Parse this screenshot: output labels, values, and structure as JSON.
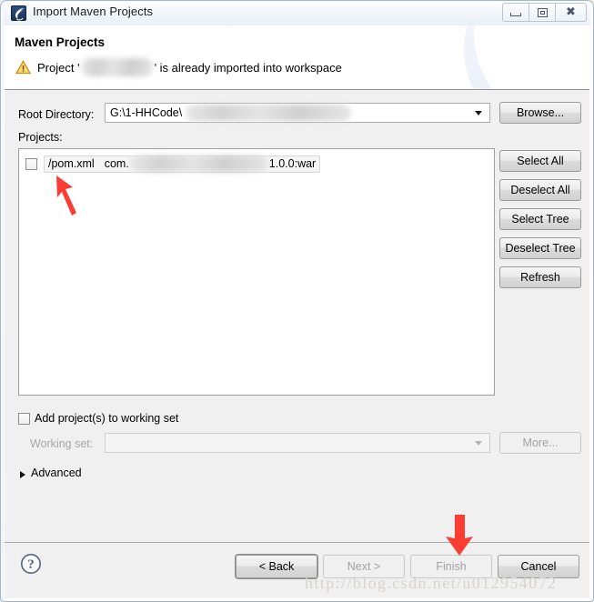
{
  "window": {
    "title": "Import Maven Projects",
    "icon": "maven-icon",
    "controls": {
      "minimize": "minimize-icon",
      "maximize": "restore-icon",
      "close": "close-icon"
    }
  },
  "banner": {
    "title": "Maven Projects",
    "status_icon": "warning-icon",
    "message_prefix": "Project '",
    "message_suffix": "' is already imported into workspace",
    "message_full": "Project '…' is already imported into workspace"
  },
  "form": {
    "root_directory_label": "Root Directory:",
    "root_directory_value": "G:\\1-HHCode\\",
    "browse_label": "Browse...",
    "projects_label": "Projects:"
  },
  "projects": {
    "rows": [
      {
        "checked": false,
        "path": "/pom.xml",
        "group": "com.",
        "version": "1.0.0:war"
      }
    ]
  },
  "side_buttons": [
    {
      "label": "Select All",
      "name": "select-all-button",
      "enabled": true
    },
    {
      "label": "Deselect All",
      "name": "deselect-all-button",
      "enabled": true
    },
    {
      "label": "Select Tree",
      "name": "select-tree-button",
      "enabled": true
    },
    {
      "label": "Deselect Tree",
      "name": "deselect-tree-button",
      "enabled": true
    },
    {
      "label": "Refresh",
      "name": "refresh-button",
      "enabled": true
    }
  ],
  "working_set": {
    "add_checkbox_label": "Add project(s) to working set",
    "add_checked": false,
    "label": "Working set:",
    "value": "",
    "more_label": "More...",
    "enabled": false
  },
  "advanced": {
    "label": "Advanced",
    "expanded": false,
    "icon": "chevron-right-icon"
  },
  "footer": {
    "help_icon": "help-icon",
    "buttons": [
      {
        "label": "< Back",
        "name": "back-button",
        "enabled": true,
        "default": true
      },
      {
        "label": "Next >",
        "name": "next-button",
        "enabled": false,
        "default": false
      },
      {
        "label": "Finish",
        "name": "finish-button",
        "enabled": false,
        "default": false
      },
      {
        "label": "Cancel",
        "name": "cancel-button",
        "enabled": true,
        "default": false
      }
    ]
  },
  "annotations": {
    "arrow_checkbox": "red-arrow-pointing-to-project-checkbox",
    "arrow_finish": "red-arrow-pointing-to-finish-button",
    "arrow_color": "#fa3c32"
  },
  "watermark": {
    "text": "http://blog.csdn.net/u012954072"
  },
  "colors": {
    "frame_border": "#9fb6cd",
    "dialog_bg": "#f0f0f0",
    "banner_bg": "#ffffff",
    "warning": "#f0b428",
    "accent": "#dfe7f5"
  }
}
